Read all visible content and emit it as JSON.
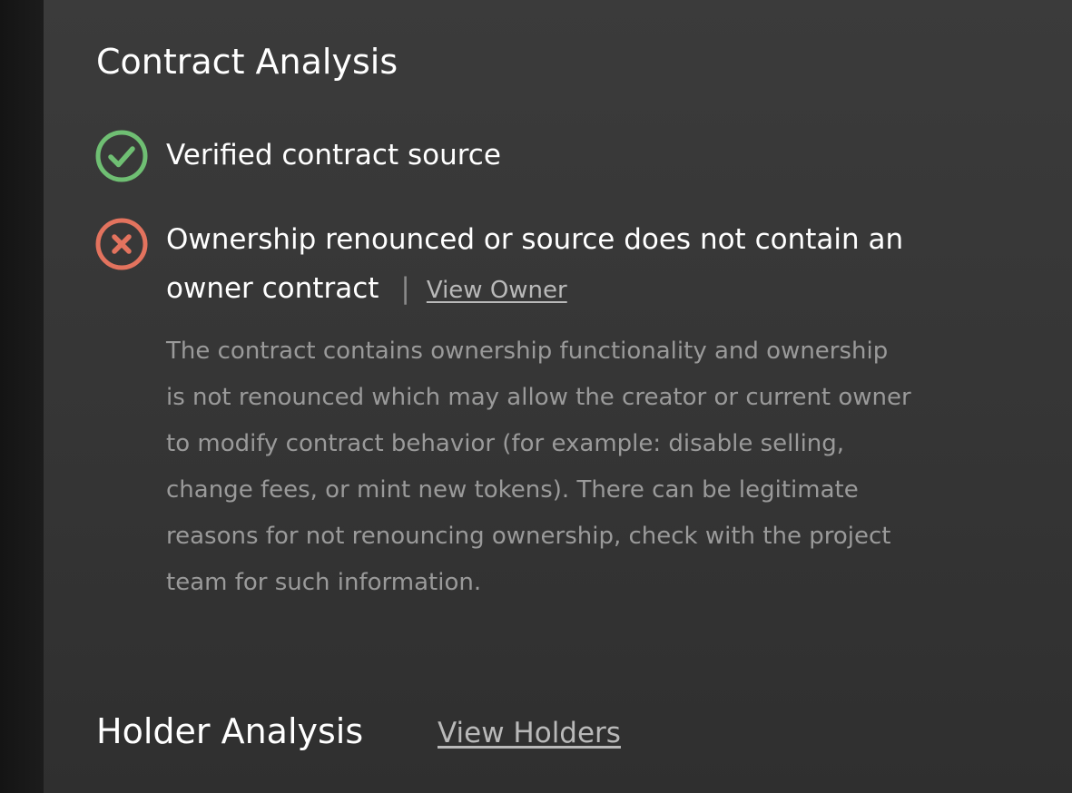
{
  "contract_analysis": {
    "title": "Contract Analysis",
    "items": [
      {
        "status": "pass",
        "icon": "check-circle-icon",
        "color": "#6fbf73",
        "text": "Verified contract source"
      },
      {
        "status": "fail",
        "icon": "x-circle-icon",
        "color": "#e3735e",
        "text_line1": "Ownership renounced or source does not contain an",
        "text_line2": "owner contract",
        "separator": "|",
        "link": "View Owner",
        "description_lines": [
          "The contract contains ownership functionality and ownership",
          "is not renounced which may allow the creator or current owner",
          "to modify contract behavior (for example: disable selling,",
          "change fees, or mint new tokens). There can be legitimate",
          "reasons for not renouncing ownership, check with the project",
          "team for such information."
        ]
      }
    ]
  },
  "holder_analysis": {
    "title": "Holder Analysis",
    "link": "View Holders"
  }
}
